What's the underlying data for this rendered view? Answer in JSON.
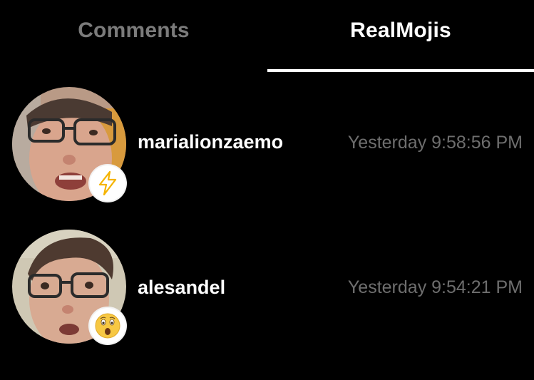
{
  "tabs": {
    "comments": "Comments",
    "realmojis": "RealMojis",
    "active": "RealMojis"
  },
  "reactions": [
    {
      "username": "marialionzaemo",
      "time": "Yesterday 9:58:56 PM",
      "badge_icon": "lightning-bolt-icon",
      "badge_color": "#f5b400"
    },
    {
      "username": "alesandel",
      "time": "Yesterday 9:54:21 PM",
      "badge_icon": "astonished-face-emoji-icon",
      "badge_color": "#f7c843"
    }
  ],
  "colors": {
    "background": "#000000",
    "active_tab": "#ffffff",
    "inactive_tab": "#7b7b7b",
    "timestamp": "#6e6e6e"
  }
}
